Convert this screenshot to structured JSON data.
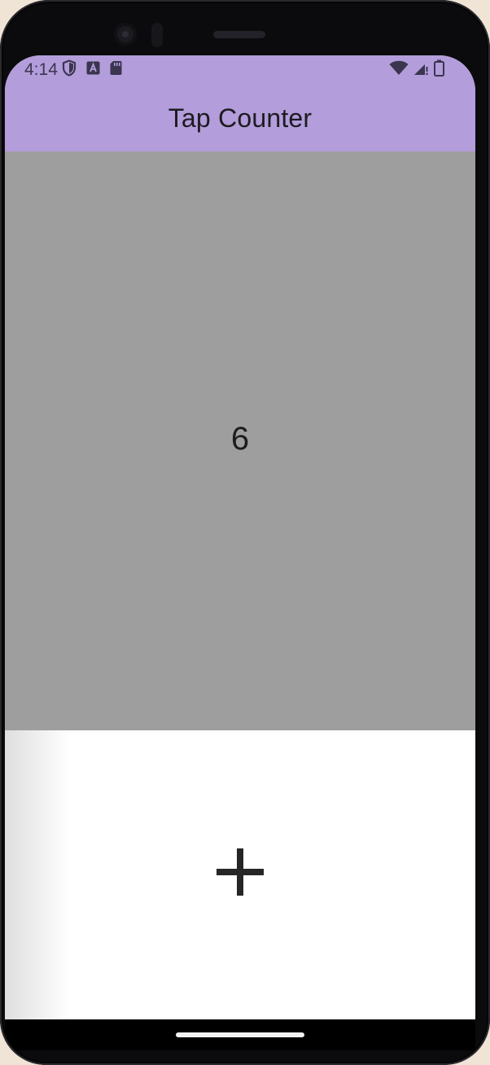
{
  "status_bar": {
    "time": "4:14",
    "icons_left": [
      "shield-icon",
      "keyboard-a-icon",
      "sd-card-icon"
    ],
    "icons_right": [
      "wifi-icon",
      "cell-signal-icon",
      "battery-icon"
    ]
  },
  "app_bar": {
    "title": "Tap Counter"
  },
  "counter": {
    "value": "6"
  },
  "increment_button": {
    "icon": "plus-icon"
  },
  "colors": {
    "app_bar_bg": "#b39ddb",
    "counter_bg": "#9e9e9e",
    "button_bg": "#ffffff",
    "text": "#1d1b20"
  }
}
